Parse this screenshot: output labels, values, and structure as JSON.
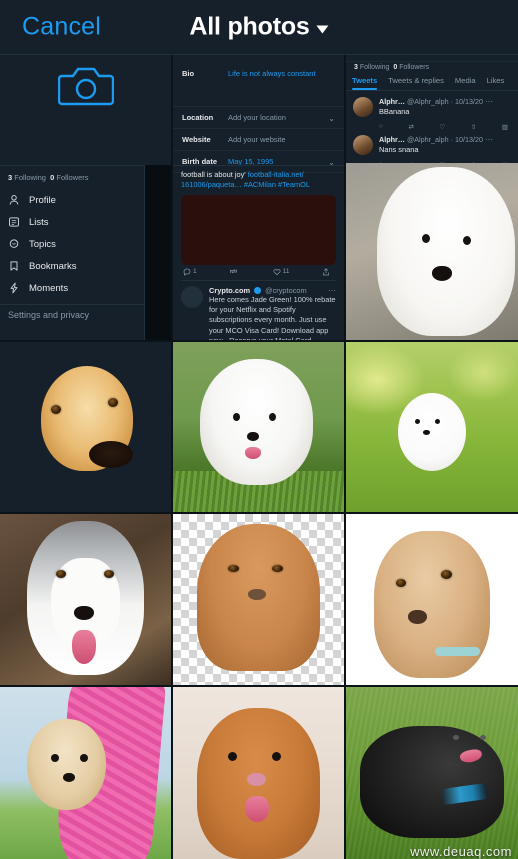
{
  "header": {
    "cancel_label": "Cancel",
    "title": "All photos",
    "caret_icon": "chevron-down-icon",
    "accent_color": "#1d9bf0",
    "background_color": "#15202b"
  },
  "gallery": {
    "camera_cell": {
      "icon": "camera-icon",
      "label": ""
    },
    "watermark": "www.deuaq.com",
    "items": [
      {
        "id": "thumb-sidebar-screenshot",
        "kind": "screenshot",
        "alt": "Twitter sidebar menu screenshot"
      },
      {
        "id": "thumb-profile-edit-screenshot",
        "kind": "screenshot",
        "alt": "Twitter edit profile screenshot"
      },
      {
        "id": "thumb-profile-tabs-screenshot",
        "kind": "screenshot",
        "alt": "Twitter profile tweets screenshot"
      },
      {
        "id": "photo-golden-dog",
        "kind": "photo",
        "alt": "Tan dog close-up on orange background"
      },
      {
        "id": "photo-samoyed-grass",
        "kind": "photo",
        "alt": "White Samoyed puppy on green grass"
      },
      {
        "id": "photo-pomeranian-grass",
        "kind": "photo",
        "alt": "White Pomeranian puppy on grass"
      },
      {
        "id": "photo-husky",
        "kind": "photo",
        "alt": "Siberian husky with tongue out"
      },
      {
        "id": "photo-vizsla-transparent",
        "kind": "photo",
        "alt": "Brown puppy on transparency checkerboard"
      },
      {
        "id": "photo-beagle-white",
        "kind": "photo",
        "alt": "Beagle puppy tilting head on white"
      },
      {
        "id": "photo-dog-pink-bag",
        "kind": "photo",
        "alt": "Small cream dog in pink carrier bag"
      },
      {
        "id": "photo-retriever-puppy",
        "kind": "photo",
        "alt": "Brown retriever puppy smiling"
      },
      {
        "id": "photo-black-staffie",
        "kind": "photo",
        "alt": "Black Staffordshire bull terrier on grass"
      }
    ]
  },
  "thumb_sidebar": {
    "following_count": "3",
    "following_label": "Following",
    "followers_count": "0",
    "followers_label": "Followers",
    "items": [
      {
        "icon": "person-icon",
        "label": "Profile"
      },
      {
        "icon": "list-icon",
        "label": "Lists"
      },
      {
        "icon": "topics-icon",
        "label": "Topics"
      },
      {
        "icon": "bookmark-icon",
        "label": "Bookmarks"
      },
      {
        "icon": "moments-icon",
        "label": "Moments"
      }
    ],
    "footer_label": "Settings and privacy"
  },
  "thumb_profile_edit": {
    "bio_label": "Bio",
    "bio_value": "Life is not always constant",
    "location_label": "Location",
    "location_placeholder": "Add your location",
    "website_label": "Website",
    "website_placeholder": "Add your website",
    "birth_label": "Birth date",
    "birth_value": "May 15, 1995"
  },
  "thumb_feed": {
    "tweet_text_line1": "football is about joy'",
    "tweet_link": "football-italia.net/",
    "tweet_link2": "161006/paqueta…",
    "hashtag1": "#ACMilan",
    "hashtag2": "#TeamOL",
    "reply_count": "1",
    "retweet_count": "",
    "like_count": "11",
    "promo_name": "Crypto.com",
    "promo_handle": "@cryptocom",
    "promo_body": "Here comes Jade Green! 100% rebate for your Netflix and Spotify subscriptions every month. Just use your MCO Visa Card! Download app now - Reserve your Metal Card"
  },
  "thumb_profile_tabs": {
    "following_count": "3",
    "following_label": "Following",
    "followers_count": "0",
    "followers_label": "Followers",
    "tabs": [
      "Tweets",
      "Tweets & replies",
      "Media",
      "Likes"
    ],
    "active_tab": "Tweets",
    "tweets": [
      {
        "name": "Alphr…",
        "handle": "@Alphr_alph",
        "date": "10/13/20",
        "body": "BBanana"
      },
      {
        "name": "Alphr…",
        "handle": "@Alphr_alph",
        "date": "10/13/20",
        "body": "Nans snana"
      }
    ]
  }
}
